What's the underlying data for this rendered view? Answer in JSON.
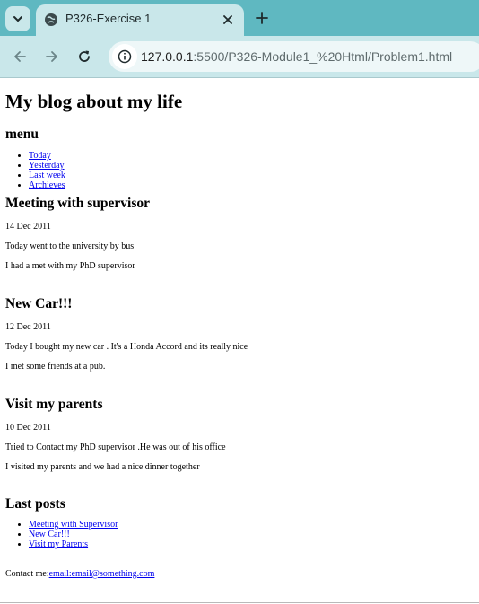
{
  "browser": {
    "tab_title": "P326-Exercise 1",
    "url_host": "127.0.0.1",
    "url_rest": ":5500/P326-Module1_%20Html/Problem1.html"
  },
  "page": {
    "title": "My blog about my life",
    "menu_heading": "menu",
    "menu_items": [
      "Today",
      "Yesterday",
      "Last week",
      "Archieves"
    ],
    "posts": [
      {
        "title": "Meeting with supervisor",
        "date": "14 Dec 2011",
        "lines": [
          "Today went to the university by bus",
          "I had a met with my PhD supervisor"
        ]
      },
      {
        "title": "New Car!!!",
        "date": "12 Dec 2011",
        "lines": [
          "Today I bought my new car . It's a Honda Accord and its really nice",
          "I met some friends at a pub."
        ]
      },
      {
        "title": "Visit my parents",
        "date": "10 Dec 2011",
        "lines": [
          "Tried to Contact my PhD supervisor .He was out of his office",
          "I visited my parents and we had a nice dinner together"
        ]
      }
    ],
    "last_posts_heading": "Last posts",
    "last_posts": [
      "Meeting with Supervisor",
      "New Car!!!",
      "Visit my Parents"
    ],
    "contact_label": "Contact me:",
    "contact_link": "email:email@something.com"
  }
}
